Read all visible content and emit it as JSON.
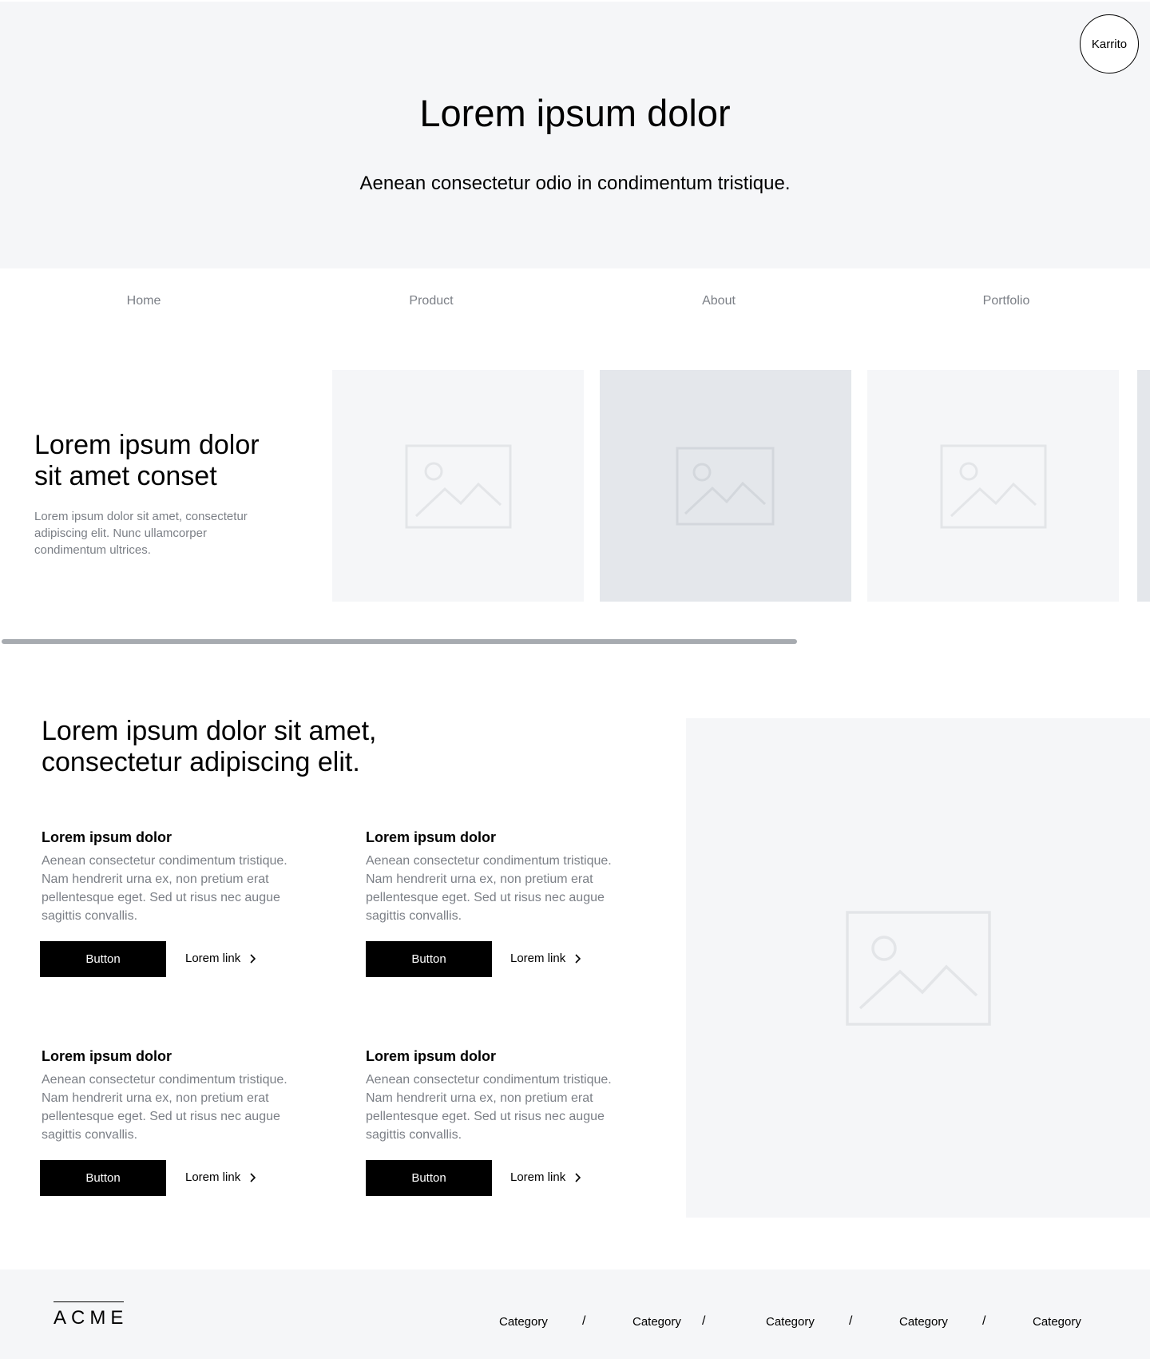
{
  "header": {
    "avatar_label": "Karrito",
    "title": "Lorem ipsum dolor",
    "subtitle": "Aenean consectetur odio in condimentum tristique."
  },
  "nav": {
    "items": [
      "Home",
      "Product",
      "About",
      "Portfolio"
    ]
  },
  "carousel": {
    "title": "Lorem ipsum dolor sit amet conset",
    "body": "Lorem ipsum dolor sit amet, consectetur adipiscing elit. Nunc ullamcorper condimentum ultrices.",
    "card_colors": [
      "#f5f6f8",
      "#e4e7eb",
      "#f5f6f8",
      "#e4e7eb"
    ]
  },
  "features": {
    "title": "Lorem ipsum dolor sit amet, consectetur adipiscing elit.",
    "items": [
      {
        "heading": "Lorem ipsum dolor",
        "text": "Aenean consectetur condimentum tristique. Nam hendrerit urna ex, non pretium erat pellentesque eget. Sed ut risus nec augue sagittis convallis.",
        "button": "Button",
        "link": "Lorem link"
      },
      {
        "heading": "Lorem ipsum dolor",
        "text": "Aenean consectetur condimentum tristique. Nam hendrerit urna ex, non pretium erat pellentesque eget. Sed ut risus nec augue sagittis convallis.",
        "button": "Button",
        "link": "Lorem link"
      },
      {
        "heading": "Lorem ipsum dolor",
        "text": "Aenean consectetur condimentum tristique. Nam hendrerit urna ex, non pretium erat pellentesque eget. Sed ut risus nec augue sagittis convallis.",
        "button": "Button",
        "link": "Lorem link"
      },
      {
        "heading": "Lorem ipsum dolor",
        "text": "Aenean consectetur condimentum tristique. Nam hendrerit urna ex, non pretium erat pellentesque eget. Sed ut risus nec augue sagittis convallis.",
        "button": "Button",
        "link": "Lorem link"
      }
    ]
  },
  "footer": {
    "logo": "ACME",
    "categories": [
      "Category",
      "Category",
      "Category",
      "Category",
      "Category"
    ],
    "separator": "/"
  }
}
